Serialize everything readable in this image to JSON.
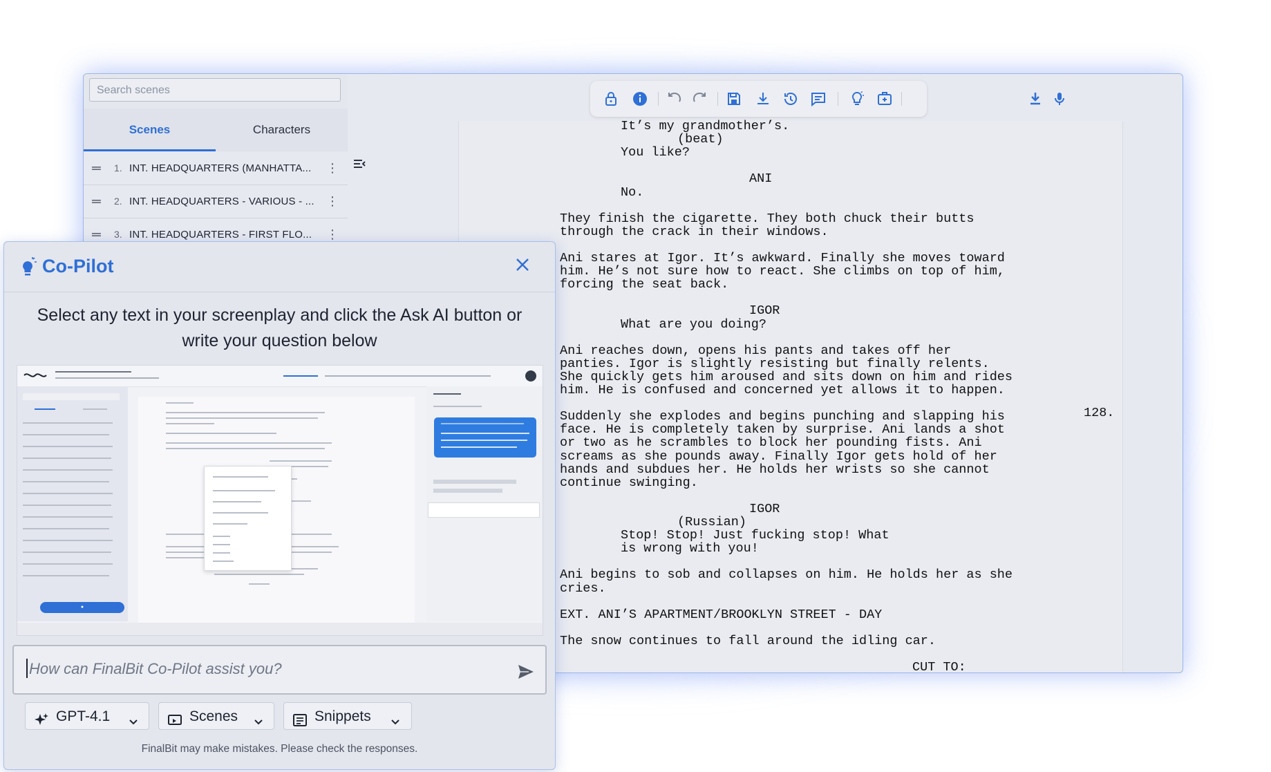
{
  "sidebar": {
    "search_placeholder": "Search scenes",
    "tabs": [
      {
        "label": "Scenes"
      },
      {
        "label": "Characters"
      }
    ],
    "scenes": [
      {
        "number": "1.",
        "title": "INT. HEADQUARTERS (MANHATTA..."
      },
      {
        "number": "2.",
        "title": "INT. HEADQUARTERS - VARIOUS - ..."
      },
      {
        "number": "3.",
        "title": "INT. HEADQUARTERS - FIRST FLO..."
      }
    ]
  },
  "toolbar": {
    "icons": [
      "lock-icon",
      "info-icon",
      "undo-icon",
      "redo-icon",
      "save-icon",
      "download-icon",
      "history-icon",
      "comment-icon",
      "lightbulb-icon",
      "add-box-icon",
      "export-icon",
      "microphone-icon"
    ]
  },
  "screenplay": {
    "page_number": "128.",
    "lines": [
      {
        "text": "It’s my grandmother’s.",
        "indent": 1
      },
      {
        "text": "(beat)",
        "indent": 2
      },
      {
        "text": "You like?",
        "indent": 1
      },
      {
        "text": "",
        "indent": 0
      },
      {
        "text": "ANI",
        "indent": 3
      },
      {
        "text": "No.",
        "indent": 1
      },
      {
        "text": "",
        "indent": 0
      },
      {
        "text": "They finish the cigarette. They both chuck their butts",
        "indent": 0
      },
      {
        "text": "through the crack in their windows.",
        "indent": 0
      },
      {
        "text": "",
        "indent": 0
      },
      {
        "text": "Ani stares at Igor. It’s awkward. Finally she moves toward",
        "indent": 0
      },
      {
        "text": "him. He’s not sure how to react. She climbs on top of him,",
        "indent": 0
      },
      {
        "text": "forcing the seat back.",
        "indent": 0
      },
      {
        "text": "",
        "indent": 0
      },
      {
        "text": "IGOR",
        "indent": 3
      },
      {
        "text": "What are you doing?",
        "indent": 1
      },
      {
        "text": "",
        "indent": 0
      },
      {
        "text": "Ani reaches down, opens his pants and takes off her",
        "indent": 0
      },
      {
        "text": "panties. Igor is slightly resisting but finally relents.",
        "indent": 0
      },
      {
        "text": "She quickly gets him aroused and sits down on him and rides",
        "indent": 0
      },
      {
        "text": "him. He is confused and concerned yet allows it to happen.",
        "indent": 0
      },
      {
        "text": "",
        "indent": 0
      },
      {
        "text": "Suddenly she explodes and begins punching and slapping his",
        "indent": 0
      },
      {
        "text": "face. He is completely taken by surprise. Ani lands a shot",
        "indent": 0
      },
      {
        "text": "or two as he scrambles to block her pounding fists. Ani",
        "indent": 0
      },
      {
        "text": "screams as she pounds away. Finally Igor gets hold of her",
        "indent": 0
      },
      {
        "text": "hands and subdues her. He holds her wrists so she cannot",
        "indent": 0
      },
      {
        "text": "continue swinging.",
        "indent": 0
      },
      {
        "text": "",
        "indent": 0
      },
      {
        "text": "IGOR",
        "indent": 3
      },
      {
        "text": "(Russian)",
        "indent": 2
      },
      {
        "text": "Stop! Stop! Just fucking stop! What",
        "indent": 1
      },
      {
        "text": "is wrong with you!",
        "indent": 1
      },
      {
        "text": "",
        "indent": 0
      },
      {
        "text": "Ani begins to sob and collapses on him. He holds her as she",
        "indent": 0
      },
      {
        "text": "cries.",
        "indent": 0
      },
      {
        "text": "",
        "indent": 0
      },
      {
        "text": "EXT. ANI’S APARTMENT/BROOKLYN STREET - DAY",
        "indent": 0
      },
      {
        "text": "",
        "indent": 0
      },
      {
        "text": "The snow continues to fall around the idling car.",
        "indent": 0
      },
      {
        "text": "",
        "indent": 0
      },
      {
        "text": "CUT TO:",
        "indent": 4
      }
    ]
  },
  "copilot": {
    "title": "Co-Pilot",
    "intro": "Select any text in your screenplay and click the Ask AI button or write your question below",
    "input_placeholder": "How can FinalBit Co-Pilot assist you?",
    "model_label": "GPT-4.1",
    "context_label": "Scenes",
    "snippets_label": "Snippets",
    "disclaimer": "FinalBit may make mistakes. Please check the responses.",
    "accent": "#2f6fd6"
  }
}
